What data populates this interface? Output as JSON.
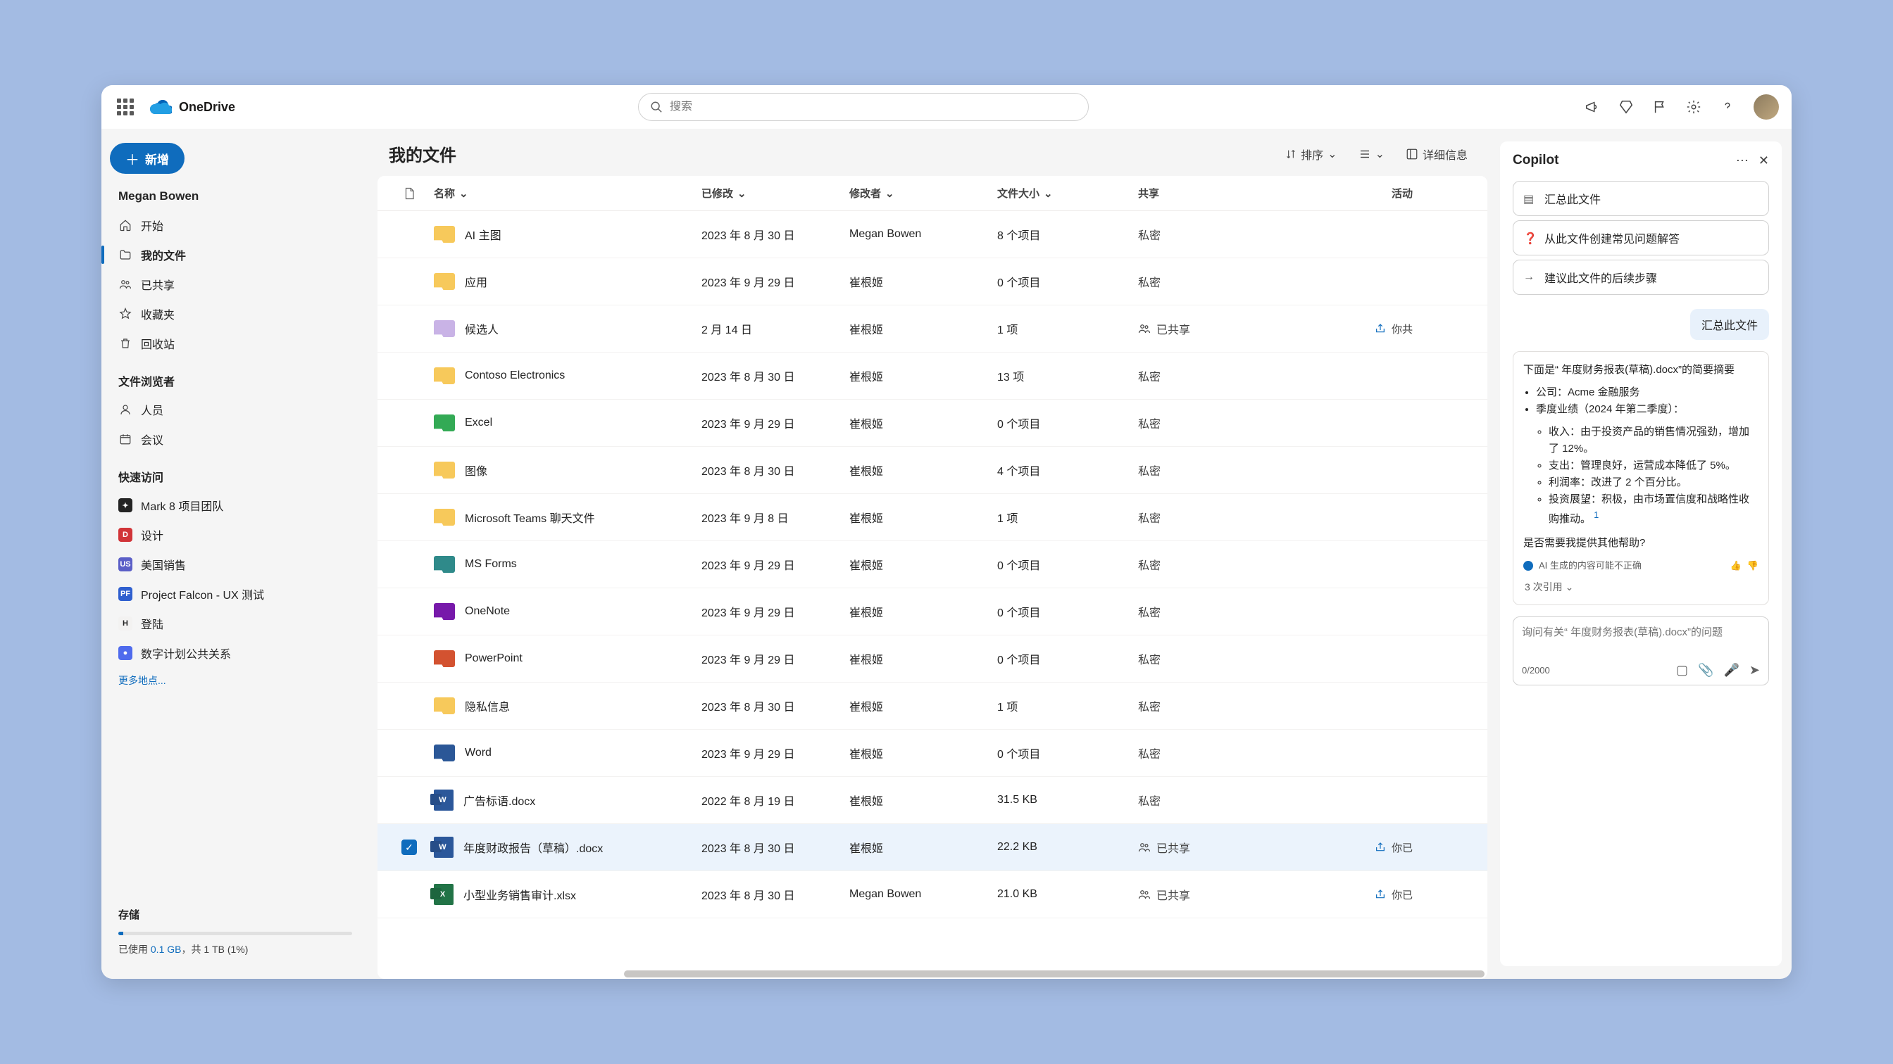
{
  "brand": "OneDrive",
  "search_placeholder": "搜索",
  "new_button": "新增",
  "user_name": "Megan Bowen",
  "nav": {
    "start": "开始",
    "my_files": "我的文件",
    "shared": "已共享",
    "favorites": "收藏夹",
    "recycle": "回收站"
  },
  "browser_heading": "文件浏览者",
  "browser": {
    "people": "人员",
    "meetings": "会议"
  },
  "quick_heading": "快速访问",
  "quick": [
    {
      "label": "Mark 8 项目团队",
      "color": "#242424",
      "badge": "✦"
    },
    {
      "label": "设计",
      "color": "#d13438",
      "badge": "D"
    },
    {
      "label": "美国销售",
      "color": "#5b5fc7",
      "badge": "US"
    },
    {
      "label": "Project Falcon - UX 测试",
      "color": "#2f5fcf",
      "badge": "PF"
    },
    {
      "label": "登陆",
      "color": "#f3f2f1",
      "badge": "H",
      "fg": "#242424"
    },
    {
      "label": "数字计划公共关系",
      "color": "#4f6bed",
      "badge": "●"
    }
  ],
  "more_places": "更多地点...",
  "storage": {
    "title": "存储",
    "prefix": "已使用 ",
    "used": "0.1 GB",
    "rest": "，共 1 TB (1%)"
  },
  "page_title": "我的文件",
  "actions": {
    "sort": "排序",
    "details": "详细信息"
  },
  "columns": {
    "name": "名称",
    "modified": "已修改",
    "modified_by": "修改者",
    "size": "文件大小",
    "sharing": "共享",
    "activity": "活动"
  },
  "shared_label": "已共享",
  "rows": [
    {
      "type": "folder",
      "color": "#f7c95b",
      "name": "AI 主图",
      "modified": "2023 年 8 月 30 日",
      "by": "Megan Bowen",
      "size": "8 个项目",
      "shared": "私密"
    },
    {
      "type": "folder",
      "color": "#f7c95b",
      "name": "应用",
      "modified": "2023 年 9 月 29 日",
      "by": "崔根姬",
      "size": "0 个项目",
      "shared": "私密"
    },
    {
      "type": "folder",
      "color": "#c9b3e6",
      "name": "候选人",
      "modified": "2 月 14 日",
      "by": "崔根姬",
      "size": "1 项",
      "shared": "已共享",
      "activity": "你共"
    },
    {
      "type": "folder",
      "color": "#f7c95b",
      "name": "Contoso Electronics",
      "modified": "2023 年 8 月 30 日",
      "by": "崔根姬",
      "size": "13 项",
      "shared": "私密"
    },
    {
      "type": "folder",
      "color": "#33aa55",
      "name": "Excel",
      "modified": "2023 年 9 月 29 日",
      "by": "崔根姬",
      "size": "0 个项目",
      "shared": "私密"
    },
    {
      "type": "folder",
      "color": "#f7c95b",
      "name": "图像",
      "modified": "2023 年 8 月 30 日",
      "by": "崔根姬",
      "size": "4 个项目",
      "shared": "私密"
    },
    {
      "type": "folder",
      "color": "#f7c95b",
      "name": "Microsoft Teams 聊天文件",
      "modified": "2023 年 9 月 8 日",
      "by": "崔根姬",
      "size": "1 项",
      "shared": "私密"
    },
    {
      "type": "folder",
      "color": "#2f8a8a",
      "name": "MS Forms",
      "modified": "2023 年 9 月 29 日",
      "by": "崔根姬",
      "size": "0 个项目",
      "shared": "私密"
    },
    {
      "type": "folder",
      "color": "#7719aa",
      "name": "OneNote",
      "modified": "2023 年 9 月 29 日",
      "by": "崔根姬",
      "size": "0 个项目",
      "shared": "私密"
    },
    {
      "type": "folder",
      "color": "#d35230",
      "name": "PowerPoint",
      "modified": "2023 年 9 月 29 日",
      "by": "崔根姬",
      "size": "0 个项目",
      "shared": "私密"
    },
    {
      "type": "folder",
      "color": "#f7c95b",
      "name": "隐私信息",
      "modified": "2023 年 8 月 30 日",
      "by": "崔根姬",
      "size": "1 项",
      "shared": "私密"
    },
    {
      "type": "folder",
      "color": "#2b5797",
      "name": "Word",
      "modified": "2023 年 9 月 29 日",
      "by": "崔根姬",
      "size": "0 个项目",
      "shared": "私密"
    },
    {
      "type": "docx",
      "name": "广告标语.docx",
      "modified": "2022 年 8 月 19 日",
      "by": "崔根姬",
      "size": "31.5 KB",
      "shared": "私密"
    },
    {
      "type": "docx",
      "name": "年度财政报告（草稿）.docx",
      "modified": "2023 年 8 月 30 日",
      "by": "崔根姬",
      "size": "22.2 KB",
      "shared": "已共享",
      "selected": true,
      "activity": "你已"
    },
    {
      "type": "xlsx",
      "name": "小型业务销售审计.xlsx",
      "modified": "2023 年 8 月 30 日",
      "by": "Megan Bowen",
      "size": "21.0 KB",
      "shared": "已共享",
      "activity": "你已"
    }
  ],
  "copilot": {
    "title": "Copilot",
    "chips": [
      "汇总此文件",
      "从此文件创建常见问题解答",
      "建议此文件的后续步骤"
    ],
    "user_msg": "汇总此文件",
    "intro": "下面是“ 年度财务报表(草稿).docx”的简要摘要",
    "b1": "公司：Acme 金融服务",
    "b2": "季度业绩（2024 年第二季度）：",
    "s1": "收入：由于投资产品的销售情况强劲，增加了 12%。",
    "s2": "支出：管理良好，运营成本降低了 5%。",
    "s3": "利润率：改进了 2 个百分比。",
    "s4": "投资展望：积极，由市场置信度和战略性收购推动。",
    "cite": "1",
    "followup": "是否需要我提供其他帮助?",
    "disclaimer": "AI 生成的内容可能不正确",
    "refs": "3 次引用",
    "placeholder": "询问有关“ 年度财务报表(草稿).docx”的问题",
    "counter": "0/2000"
  }
}
